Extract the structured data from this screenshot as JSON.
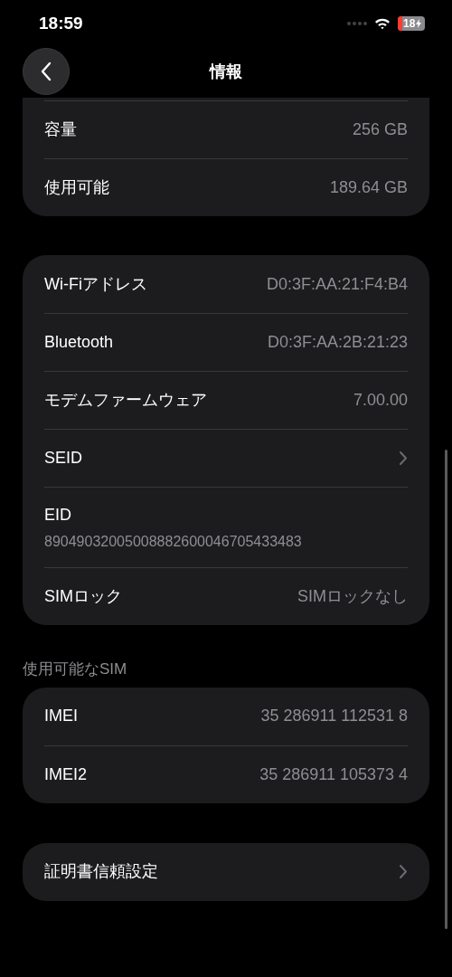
{
  "status_bar": {
    "time": "18:59",
    "battery": "18"
  },
  "nav": {
    "title": "情報"
  },
  "sections": [
    {
      "rows": [
        {
          "kind": "value",
          "label": "容量",
          "value": "256 GB"
        },
        {
          "kind": "value",
          "label": "使用可能",
          "value": "189.64 GB"
        }
      ]
    },
    {
      "rows": [
        {
          "kind": "value",
          "label": "Wi-Fiアドレス",
          "value": "D0:3F:AA:21:F4:B4"
        },
        {
          "kind": "value",
          "label": "Bluetooth",
          "value": "D0:3F:AA:2B:21:23"
        },
        {
          "kind": "value",
          "label": "モデムファームウェア",
          "value": "7.00.00"
        },
        {
          "kind": "link",
          "label": "SEID"
        },
        {
          "kind": "stacked",
          "label": "EID",
          "value": "89049032005008882600046705433483"
        },
        {
          "kind": "value",
          "label": "SIMロック",
          "value": "SIMロックなし"
        }
      ]
    },
    {
      "header": "使用可能なSIM",
      "rows": [
        {
          "kind": "value",
          "label": "IMEI",
          "value": "35 286911 112531 8"
        },
        {
          "kind": "value",
          "label": "IMEI2",
          "value": "35 286911 105373 4"
        }
      ]
    },
    {
      "rows": [
        {
          "kind": "link",
          "label": "証明書信頼設定"
        }
      ]
    }
  ]
}
